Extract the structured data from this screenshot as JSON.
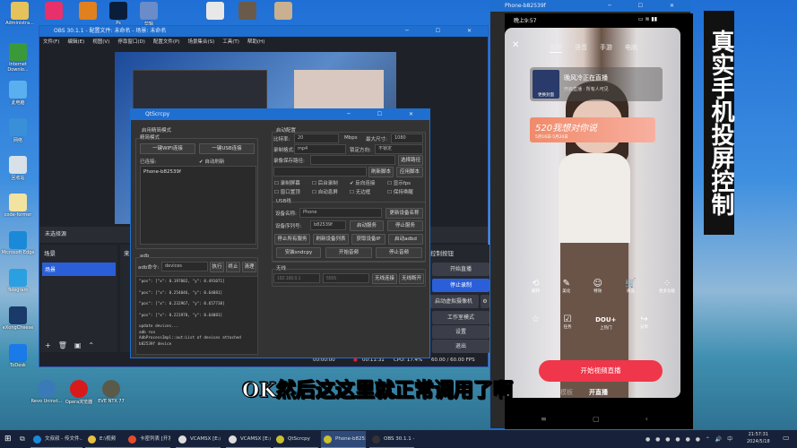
{
  "desktop": {
    "top_icons": [
      {
        "label": "Administra...",
        "color": "#e6c25a"
      },
      {
        "label": "",
        "color": "#e8306a"
      },
      {
        "label": "",
        "color": "#e0801e"
      },
      {
        "label": "Ps",
        "color": "#0a1e3c"
      },
      {
        "label": "剪辑",
        "color": "#6a8cc8"
      },
      {
        "label": "",
        "color": "#e8e8e8"
      },
      {
        "label": "",
        "color": "#6a5a4a"
      },
      {
        "label": "",
        "color": "#c8b090"
      }
    ],
    "left_icons": [
      {
        "label": "Internet Downlo...",
        "color": "#3a9a3a"
      },
      {
        "label": "此电脑",
        "color": "#5ab0ee"
      },
      {
        "label": "网络",
        "color": "#3a90d8"
      },
      {
        "label": "回收站",
        "color": "#d8e0e8"
      },
      {
        "label": "code-former",
        "color": "#f2e3a0"
      },
      {
        "label": "Microsoft Edge",
        "color": "#1a8ad8"
      },
      {
        "label": "Telegram",
        "color": "#2aa0e0"
      },
      {
        "label": "eXongCheese",
        "color": "#1a3a6a"
      },
      {
        "label": "ToDesk",
        "color": "#1a7ae8"
      }
    ],
    "bottom_icons": [
      {
        "label": "Revo Uninst...",
        "color": "#3a7ab8"
      },
      {
        "label": "Opera浏览器",
        "color": "#d81a1a"
      },
      {
        "label": "EVE NTX 77",
        "color": "#5a5a4a"
      }
    ]
  },
  "obs": {
    "title": "OBS 30.1.1 - 配置文件: 未命名 - 场景: 未命名",
    "menu": [
      "文件(F)",
      "编辑(E)",
      "视图(V)",
      "停靠窗口(D)",
      "配置文件(P)",
      "场景集合(S)",
      "工具(T)",
      "帮助(H)"
    ],
    "no_source": "未选择源",
    "scenes_title": "场景",
    "scene_item": "场景",
    "sources_title": "来",
    "controls_title": "控制按钮",
    "controls": [
      "开始直播",
      "停止录制",
      "启动虚拟摄像机",
      "工作室模式",
      "设置",
      "退出"
    ],
    "status": {
      "stream_time": "00:00:00",
      "rec_time": "00:11:31",
      "cpu": "CPU: 17.4%",
      "fps": "60.00 / 60.00 FPS"
    },
    "accent": "#2b5fd9"
  },
  "qtscrcpy": {
    "title": "QtScrcpy",
    "usb_mode": "启用精简模式",
    "mode_group": "精简模式",
    "wifi_btn": "一键WIFI连接",
    "usb_btn": "一键USB连接",
    "connected": "已连接:",
    "auto_refresh": "自动刷新",
    "devices": [
      "Phone-b82539f"
    ],
    "start_group": "启动配置",
    "bitrate_label": "比特率:",
    "bitrate": "20",
    "unit": "Mbps",
    "maxsize_label": "最大尺寸:",
    "maxsize": "1080",
    "format_label": "录制格式:",
    "format": "mp4",
    "orient_label": "锁定方向:",
    "orient": "不锁定",
    "path_label": "录像保存路径:",
    "path_btn": "选择路径",
    "refresh_script": "刷新脚本",
    "apply_script": "应用脚本",
    "checks": [
      "录制屏幕",
      "后台录制",
      "反向连接",
      "显示fps",
      "窗口置顶",
      "自动息屏",
      "无边框",
      "保持唤醒"
    ],
    "usb_group": "USB线",
    "name_label": "设备名称:",
    "name": "Phone",
    "update_name": "更新设备名称",
    "serial_label": "设备序列号:",
    "serial": "b82539f",
    "start_service": "启动服务",
    "stop_service": "停止服务",
    "stop_all": "停止所有服务",
    "refresh_list": "刷新设备列表",
    "get_ip": "获取设备IP",
    "start_adbd": "启动adbd",
    "install_sndcpy": "安装sndcpy",
    "start_audio": "开始音频",
    "stop_audio": "停止音频",
    "wireless_group": "无线",
    "ip_placeholder": "192.168.0.1",
    "port_placeholder": "5555",
    "wifi_connect": "无线连接",
    "wifi_disconnect": "无线断开",
    "adb_group": "adb",
    "adb_label": "adb命令:",
    "adb_cmd": "devices",
    "exec": "执行",
    "stop": "终止",
    "clear": "清理",
    "log": [
      "\"pos\": [\"x\": 0.197002, \"y\": 0.491071]",
      "\"pos\": [\"x\": 0.254046, \"y\": 0.64081]",
      "\"pos\": [\"x\": 0.232967, \"y\": 0.657738]",
      "\"pos\": [\"x\": 0.221978, \"y\": 0.64081]",
      "update devices...",
      "adb run",
      "AdbProcessImpl::out:List of devices attached",
      "b82539f          device"
    ]
  },
  "phone": {
    "title": "Phone-b82539f",
    "time": "晚上9:57",
    "tabs": [
      "视频",
      "语音",
      "手游",
      "电脑"
    ],
    "streamer": "晚风冷正在直播",
    "sub": "开启直播   ·  所有人可见",
    "cover": "更换封面",
    "banner": "520我想对你说",
    "banner_date": "5月16日-5月20日",
    "tools_row1": [
      "翻转",
      "美化",
      "特效",
      "商品",
      "更多功能"
    ],
    "tools_row2": [
      "",
      "任务",
      "上热门",
      "分享"
    ],
    "dou": "DOU+",
    "start_live": "开始视频直播",
    "bottom_tabs": [
      "模板",
      "开直播"
    ]
  },
  "side_caption": "真实手机投屏控制",
  "subtitle": "OK然后这这里就正常调用了啊",
  "taskbar": {
    "items": [
      {
        "label": "文叔叔 - 传文件...",
        "color": "#1a8ad8"
      },
      {
        "label": "E:\\视频",
        "color": "#e8c040"
      },
      {
        "label": "卡密列表 [开发者...",
        "color": "#e84a2a"
      },
      {
        "label": "VCAMSX [E:/code...",
        "color": "#ddd"
      },
      {
        "label": "VCAMSX [E:/code...",
        "color": "#ddd"
      },
      {
        "label": "QtScrcpy",
        "color": "#c8c030"
      },
      {
        "label": "Phone-b82539f",
        "color": "#c8c030"
      },
      {
        "label": "OBS 30.1.1 - 配置...",
        "color": "#333"
      }
    ],
    "clock_time": "21:57:31",
    "clock_date": "2024/5/18",
    "ime": "中"
  }
}
